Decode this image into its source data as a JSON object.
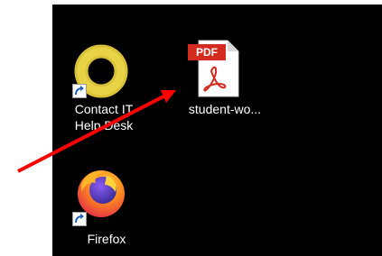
{
  "desktop": {
    "background": "#000000",
    "icons": [
      {
        "name": "Contact IT Help Desk",
        "label_line1": "Contact IT",
        "label_line2": "Help Desk",
        "icon": "lifebuoy-icon",
        "shortcut": true
      },
      {
        "name": "student-wo...",
        "label_line1": "student-wo...",
        "icon": "pdf-file-icon",
        "badge": "PDF",
        "shortcut": false
      },
      {
        "name": "Firefox",
        "label_line1": "Firefox",
        "icon": "firefox-icon",
        "shortcut": true
      }
    ]
  },
  "annotation": {
    "type": "arrow",
    "color": "#ff0000",
    "points_to": "student-wo..."
  }
}
